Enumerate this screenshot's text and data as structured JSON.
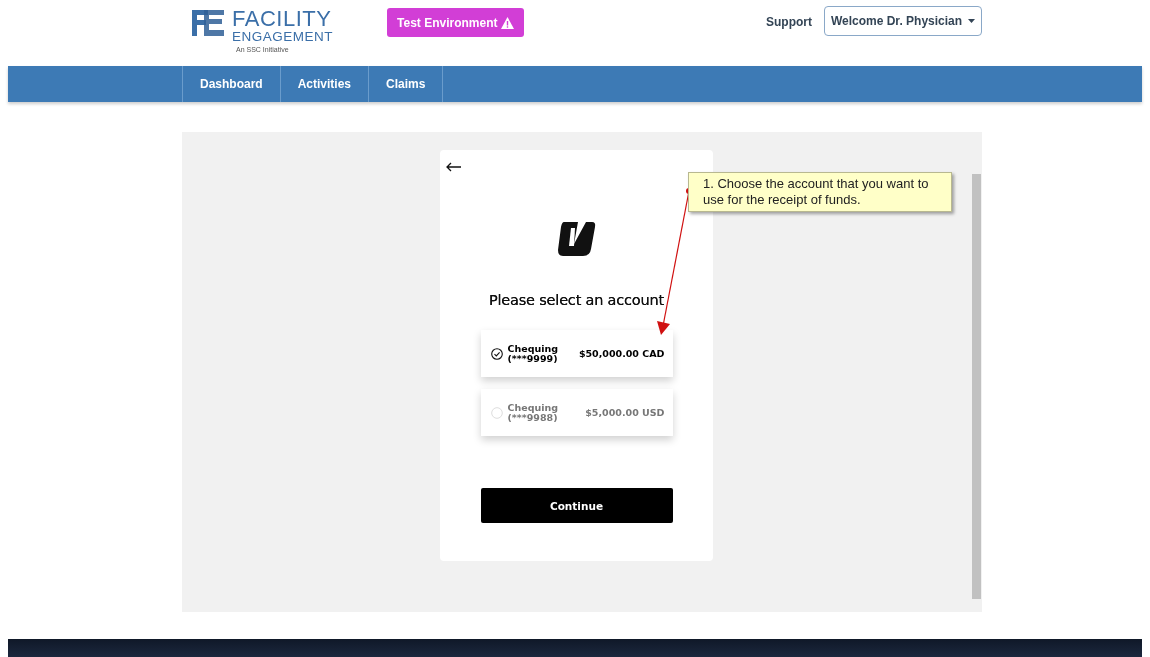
{
  "header": {
    "logo_title": "FACILITY",
    "logo_subtitle": "ENGAGEMENT",
    "logo_tagline": "An SSC Initiative",
    "env_badge": "Test Environment",
    "support_link": "Support",
    "user_menu": "Welcome Dr. Physician"
  },
  "nav": [
    {
      "label": "Dashboard",
      "selected": false
    },
    {
      "label": "Activities",
      "selected": false
    },
    {
      "label": "Claims",
      "selected": false
    }
  ],
  "dialog": {
    "heading": "Please select an account",
    "accounts": [
      {
        "name": "Chequing",
        "number": "(***9999)",
        "amount": "$50,000.00 CAD",
        "selected": true
      },
      {
        "name": "Chequing",
        "number": "(***9988)",
        "amount": "$5,000.00 USD",
        "selected": false
      }
    ],
    "continue": "Continue"
  },
  "annotation": {
    "text": "1. Choose the account that you want to use for the receipt of funds."
  }
}
